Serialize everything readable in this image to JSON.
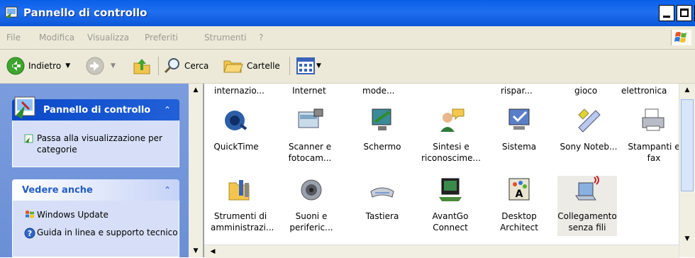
{
  "window": {
    "title": "Pannello di controllo"
  },
  "menu": [
    "File",
    "Modifica",
    "Visualizza",
    "Preferiti",
    "Strumenti",
    "?"
  ],
  "toolbar": {
    "back": "Indietro",
    "search": "Cerca",
    "folders": "Cartelle"
  },
  "left_panel": {
    "control_panel_title": "Pannello di controllo",
    "switch_view": "Passa alla visualizzazione per categorie",
    "see_also_title": "Vedere anche",
    "windows_update": "Windows Update",
    "help": "Guida in linea e supporto tecnico"
  },
  "top_partial": [
    "internazio...",
    "Internet",
    "mode...",
    "rispar...",
    "gioco",
    "elettronica"
  ],
  "items_row1": [
    {
      "label": "QuickTime",
      "icon": "quicktime-icon"
    },
    {
      "label": "Scanner e fotocam...",
      "icon": "scanner-icon"
    },
    {
      "label": "Schermo",
      "icon": "display-icon"
    },
    {
      "label": "Sintesi e riconoscime...",
      "icon": "speech-icon"
    },
    {
      "label": "Sistema",
      "icon": "system-icon"
    },
    {
      "label": "Sony Noteb...",
      "icon": "sony-icon"
    },
    {
      "label": "Stampanti e fax",
      "icon": "printer-icon"
    }
  ],
  "items_row2": [
    {
      "label": "Strumenti di amministrazi...",
      "icon": "admin-tools-icon"
    },
    {
      "label": "Suoni e periferic...",
      "icon": "speaker-icon"
    },
    {
      "label": "Tastiera",
      "icon": "keyboard-icon"
    },
    {
      "label": "AvantGo Connect",
      "icon": "avantgo-icon"
    },
    {
      "label": "Desktop Architect",
      "icon": "desktop-architect-icon"
    },
    {
      "label": "Collegamento senza fili",
      "icon": "wireless-icon"
    }
  ],
  "colors": {
    "title_bar": "#0a5fe8",
    "panel_head": "#ffffff",
    "panel_body": "#d6dff7",
    "left_pane": "#6b8fd6",
    "accent_text": "#215dc6"
  }
}
